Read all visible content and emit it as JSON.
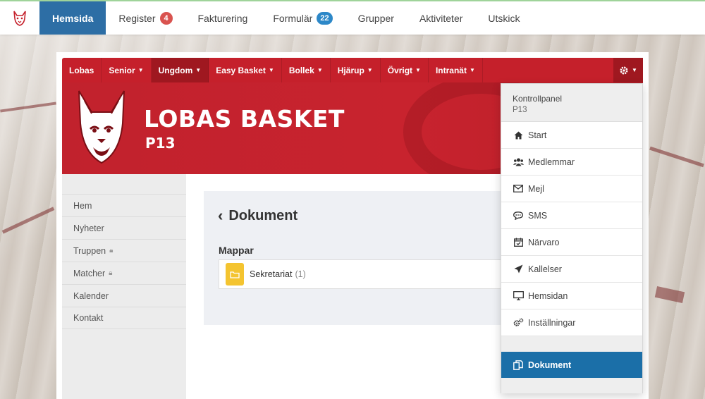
{
  "topbar": {
    "tabs": [
      {
        "label": "Hemsida"
      },
      {
        "label": "Register",
        "badge": "4"
      },
      {
        "label": "Fakturering"
      },
      {
        "label": "Formulär",
        "badge": "22"
      },
      {
        "label": "Grupper"
      },
      {
        "label": "Aktiviteter"
      },
      {
        "label": "Utskick"
      }
    ],
    "active_tab": "Hemsida"
  },
  "site_nav": {
    "items": [
      {
        "label": "Lobas"
      },
      {
        "label": "Senior"
      },
      {
        "label": "Ungdom"
      },
      {
        "label": "Easy Basket"
      },
      {
        "label": "Bollek"
      },
      {
        "label": "Hjärup"
      },
      {
        "label": "Övrigt"
      },
      {
        "label": "Intranät"
      }
    ],
    "active": "Ungdom",
    "settings_icon": "gear-icon"
  },
  "banner": {
    "title": "LOBAS BASKET",
    "subtitle": "P13"
  },
  "sidebar": {
    "items": [
      {
        "label": "Hem"
      },
      {
        "label": "Nyheter"
      },
      {
        "label": "Truppen"
      },
      {
        "label": "Matcher"
      },
      {
        "label": "Kalender"
      },
      {
        "label": "Kontakt"
      }
    ]
  },
  "content": {
    "title": "Dokument",
    "folders_heading": "Mappar",
    "folders": [
      {
        "name": "Sekretariat",
        "count": "(1)"
      }
    ]
  },
  "dropdown": {
    "heading": "Kontrollpanel",
    "subheading": "P13",
    "items": [
      {
        "label": "Start",
        "icon": "home-icon"
      },
      {
        "label": "Medlemmar",
        "icon": "users-icon"
      },
      {
        "label": "Mejl",
        "icon": "envelope-icon"
      },
      {
        "label": "SMS",
        "icon": "chat-icon"
      },
      {
        "label": "Närvaro",
        "icon": "calendar-check-icon"
      },
      {
        "label": "Kallelser",
        "icon": "paper-plane-icon"
      },
      {
        "label": "Hemsidan",
        "icon": "monitor-icon"
      },
      {
        "label": "Inställningar",
        "icon": "gears-icon"
      }
    ],
    "active_item": {
      "label": "Dokument",
      "icon": "documents-icon"
    }
  },
  "colors": {
    "brand_red": "#c5202b",
    "brand_red_dark": "#9f1820",
    "active_blue": "#2d6ea5",
    "dropdown_active": "#1b6fa8",
    "badge_red": "#d9534f",
    "badge_blue": "#2d88c8",
    "folder_yellow": "#f4c430"
  }
}
